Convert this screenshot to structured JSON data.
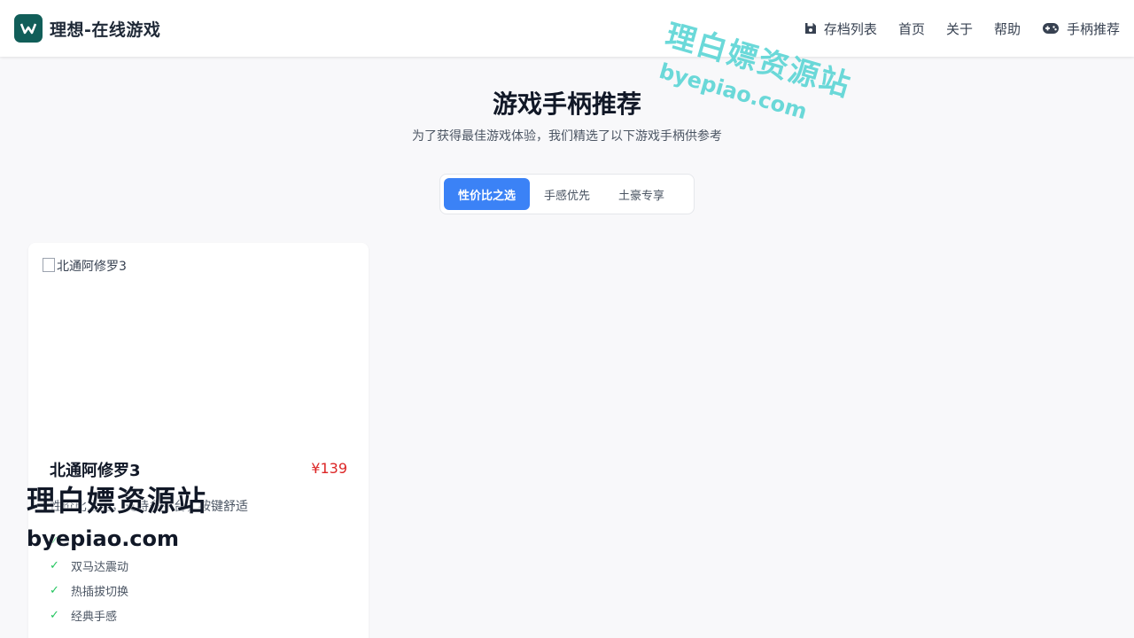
{
  "header": {
    "brand_title": "理想-在线游戏",
    "nav": [
      {
        "label": "存档列表",
        "icon": "save-icon"
      },
      {
        "label": "首页"
      },
      {
        "label": "关于"
      },
      {
        "label": "帮助"
      },
      {
        "label": "手柄推荐",
        "icon": "gamepad-icon"
      }
    ]
  },
  "hero": {
    "title": "游戏手柄推荐",
    "subtitle": "为了获得最佳游戏体验，我们精选了以下游戏手柄供参考"
  },
  "tabs": [
    {
      "label": "性价比之选",
      "active": true
    },
    {
      "label": "手感优先",
      "active": false
    },
    {
      "label": "土豪专享",
      "active": false
    }
  ],
  "products": [
    {
      "image_alt": "北通阿修罗3",
      "name": "北通阿修罗3",
      "price": "¥139",
      "description": "性价比之王，支持多平台，按键舒适",
      "features": [
        "",
        "双马达震动",
        "热插拔切换",
        "经典手感"
      ]
    }
  ],
  "watermark": {
    "name": "理白嫖资源站",
    "url": "byepiao.com"
  },
  "colors": {
    "accent": "#3b82f6",
    "brand": "#115e59",
    "price": "#dc2626",
    "check": "#22c55e"
  }
}
